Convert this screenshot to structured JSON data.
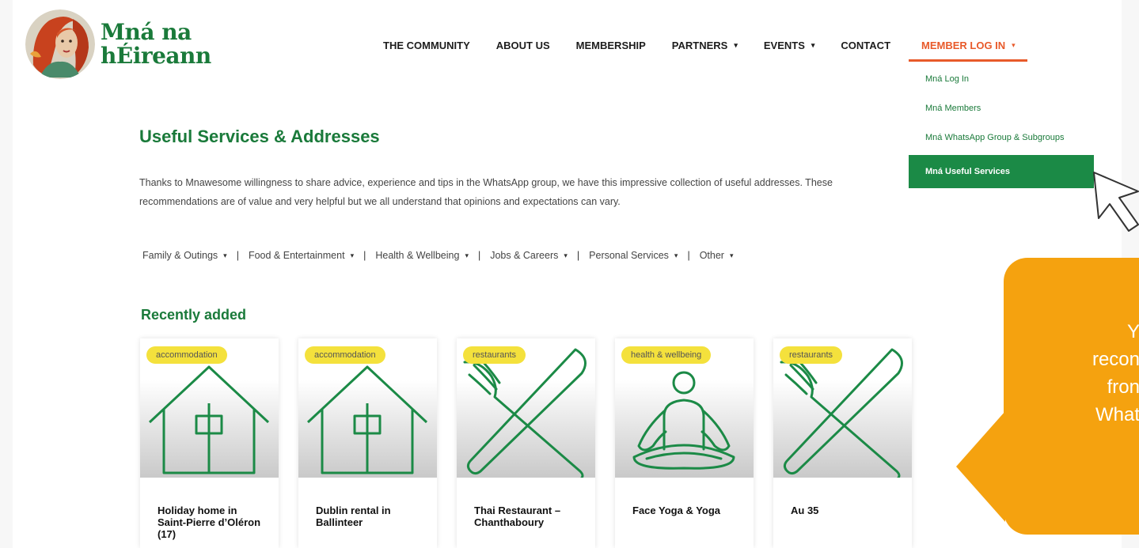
{
  "logo": {
    "line1": "Mná na",
    "line2": "hÉireann"
  },
  "nav": {
    "items": [
      {
        "label": "THE COMMUNITY",
        "caret": false
      },
      {
        "label": "ABOUT US",
        "caret": false
      },
      {
        "label": "MEMBERSHIP",
        "caret": false
      },
      {
        "label": "PARTNERS",
        "caret": true
      },
      {
        "label": "EVENTS",
        "caret": true
      },
      {
        "label": "CONTACT",
        "caret": false
      }
    ],
    "active_label": "MEMBER LOG IN",
    "caret_glyph": "▾"
  },
  "dropdown": {
    "items": [
      "Mná Log In",
      "Mná Members",
      "Mná WhatsApp Group & Subgroups",
      "Mná Useful Services"
    ]
  },
  "page": {
    "title": "Useful Services & Addresses",
    "intro": "Thanks to Mnawesome willingness to share advice, experience and tips in the WhatsApp group, we have this impressive collection of useful addresses. These recommendations are of value and very helpful but we all understand that opinions and expectations can vary."
  },
  "categories": [
    "Family & Outings",
    "Food & Entertainment",
    "Health & Wellbeing",
    "Jobs & Careers",
    "Personal Services",
    "Other"
  ],
  "separator": "|",
  "recent_heading": "Recently added",
  "cards": [
    {
      "tag": "accommodation",
      "title": "Holiday home in Saint-Pierre d’Oléron (17)",
      "icon": "house-icon"
    },
    {
      "tag": "accommodation",
      "title": "Dublin rental in Ballinteer",
      "icon": "house-icon"
    },
    {
      "tag": "restaurants",
      "title": "Thai Restaurant – Chanthaboury",
      "icon": "fork-knife-icon"
    },
    {
      "tag": "health & wellbeing",
      "title": "Face Yoga & Yoga",
      "icon": "yoga-icon"
    },
    {
      "tag": "restaurants",
      "title": "Au 35",
      "icon": "fork-knife-icon"
    }
  ],
  "bubble": {
    "lines": [
      "Y",
      "recon",
      "fron",
      "What"
    ]
  },
  "colors": {
    "brand_green": "#1a7a3a",
    "accent_orange": "#e85a2a",
    "tag_yellow": "#f4e13c",
    "bubble_orange": "#f5a20f"
  }
}
